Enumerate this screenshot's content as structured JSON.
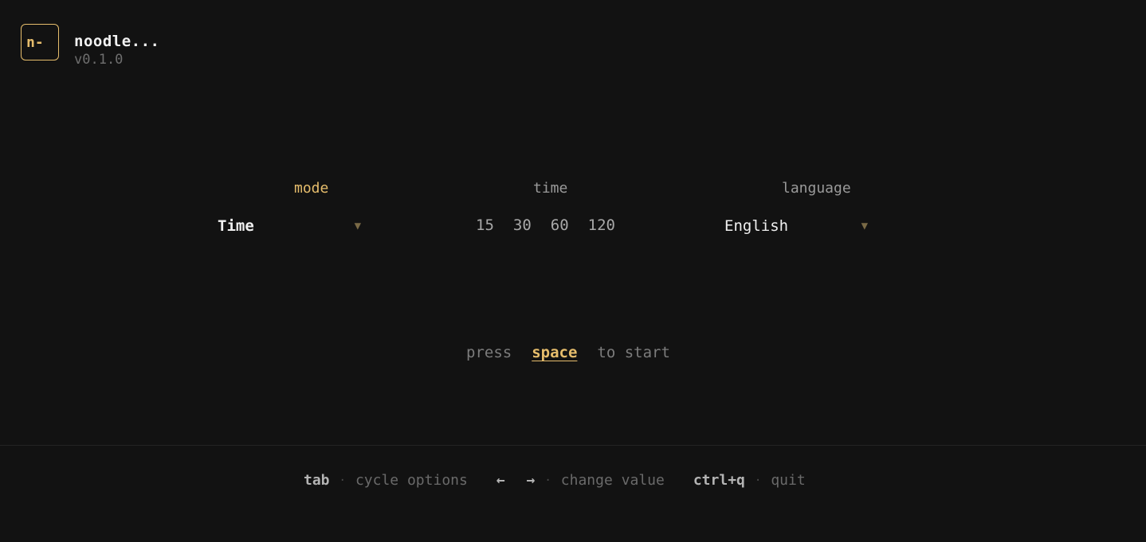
{
  "brand": {
    "logo_text": "n-",
    "name": "noodle...",
    "version": "v0.1.0"
  },
  "settings": {
    "mode": {
      "label": "mode",
      "value": "Time",
      "active": true
    },
    "time": {
      "label": "time",
      "options": [
        "15",
        "30",
        "60",
        "120"
      ]
    },
    "language": {
      "label": "language",
      "value": "English"
    }
  },
  "prompt": {
    "before": "press",
    "key": "space",
    "after": "to start"
  },
  "footer": {
    "cycle": {
      "key": "tab",
      "desc": "cycle options"
    },
    "change": {
      "key": "← →",
      "desc": "change value"
    },
    "quit": {
      "key": "ctrl+q",
      "desc": "quit"
    },
    "separator": "·"
  },
  "colors": {
    "accent": "#e6bd6c",
    "background": "#121212"
  }
}
